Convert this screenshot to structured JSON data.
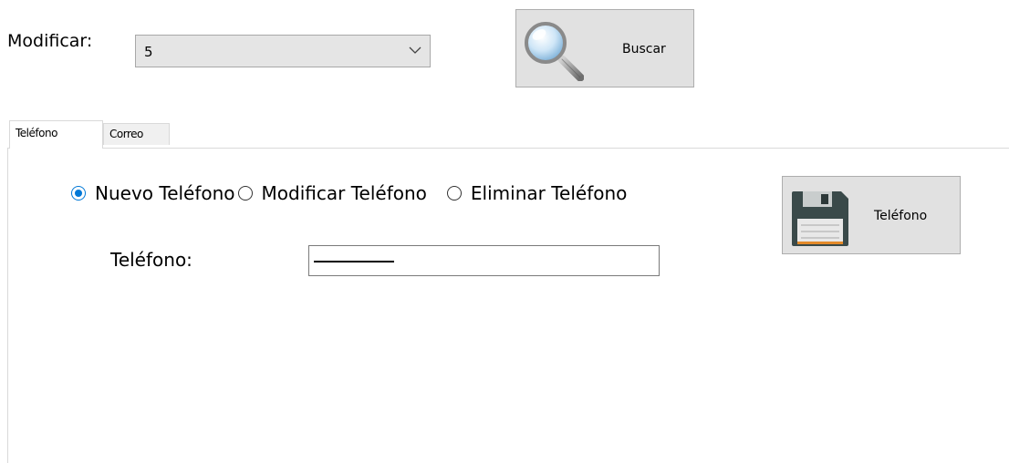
{
  "top": {
    "modificar_label": "Modificar:",
    "combo_value": "5",
    "buscar_label": "Buscar"
  },
  "tabs": [
    {
      "label": "Teléfono",
      "active": true
    },
    {
      "label": "Correo",
      "active": false
    }
  ],
  "telefono_tab": {
    "radios": [
      {
        "label": "Nuevo Teléfono",
        "checked": true
      },
      {
        "label": "Modificar Teléfono",
        "checked": false
      },
      {
        "label": "Eliminar Teléfono",
        "checked": false
      }
    ],
    "field_label": "Teléfono:",
    "field_value": "",
    "save_button_label": "Teléfono"
  },
  "colors": {
    "accent": "#0078d7",
    "button_face": "#e1e1e1",
    "combo_face": "#e5e5e5"
  },
  "icons": {
    "buscar": "magnifier-icon",
    "save": "floppy-disk-icon"
  }
}
